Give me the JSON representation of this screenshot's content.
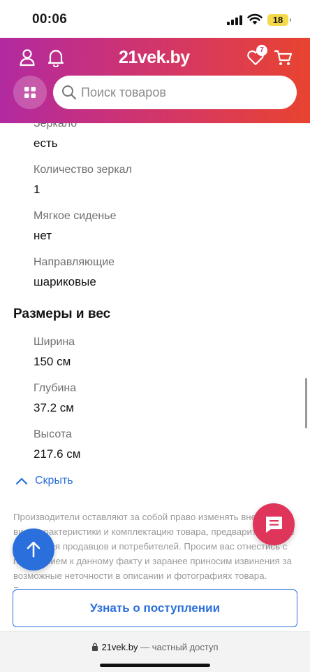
{
  "status_bar": {
    "time": "00:06",
    "battery": "18"
  },
  "header": {
    "logo": "21vek.by",
    "favorites_count": "7",
    "search": {
      "placeholder": "Поиск товаров"
    }
  },
  "specs_top": [
    {
      "label": "Зеркало",
      "value": "есть"
    },
    {
      "label": "Количество зеркал",
      "value": "1"
    },
    {
      "label": "Мягкое сиденье",
      "value": "нет"
    },
    {
      "label": "Направляющие",
      "value": "шариковые"
    }
  ],
  "dimensions": {
    "title": "Размеры и вес",
    "items": [
      {
        "label": "Ширина",
        "value": "150 см"
      },
      {
        "label": "Глубина",
        "value": "37.2 см"
      },
      {
        "label": "Высота",
        "value": "217.6 см"
      }
    ]
  },
  "collapse_label": "Скрыть",
  "disclaimer": "Производители оставляют за собой право изменять внешний вид, характеристики и комплектацию товара, предварительно не уведомляя продавцов и потребителей. Просим вас отнестись с пониманием к данному факту и заранее приносим извинения за возможные неточности в описании и фотографиях товара. Благодарим",
  "notify_button": "Узнать о поступлении",
  "browser": {
    "domain": "21vek.by",
    "suffix": " — частный доступ"
  },
  "colors": {
    "accent": "#2a6fdb",
    "chat": "#e0355b",
    "header_start": "#b12aa0",
    "header_end": "#e8432f"
  }
}
